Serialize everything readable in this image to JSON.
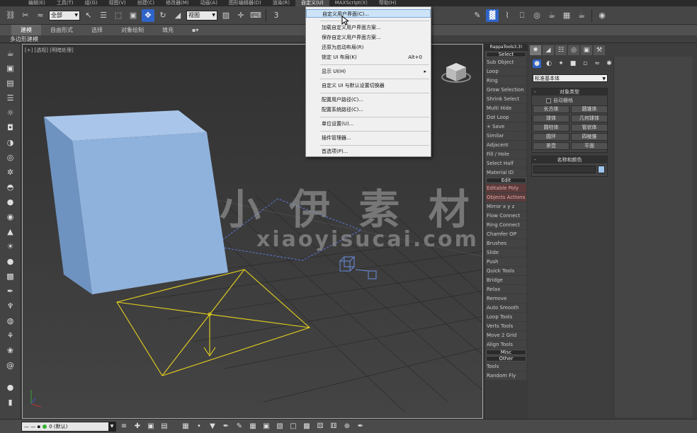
{
  "menubar": {
    "items": [
      "编辑(E)",
      "工具(T)",
      "组(G)",
      "视图(V)",
      "创建(C)",
      "修改器(M)",
      "动画(A)",
      "图形编辑器(D)",
      "渲染(R)",
      "自定义(U)",
      "MAXScript(X)",
      "帮助(H)"
    ]
  },
  "toolbar": {
    "selection_filter": "全部",
    "coord_system": "视图",
    "snap_value": "3"
  },
  "ribbon": {
    "tabs": [
      "建模",
      "自由形式",
      "选择",
      "对象绘制",
      "填充"
    ],
    "subpanel": "多边形建模"
  },
  "viewport": {
    "label": "[+] [透视] [明暗处理]",
    "watermark_main": "小 伊 素 材 网",
    "watermark_sub": "xiaoyisucai.com"
  },
  "dropdown": {
    "items": [
      {
        "label": "自定义用户界面(C)...",
        "shortcut": "",
        "highlighted": true
      },
      {
        "label": "加载自定义用户界面方案...",
        "shortcut": ""
      },
      {
        "label": "保存自定义用户界面方案...",
        "shortcut": ""
      },
      {
        "label": "还原为启动布局(R)",
        "shortcut": ""
      },
      {
        "label": "锁定 UI 布局(K)",
        "shortcut": "Alt+0"
      },
      {
        "label": "显示 UI(H)",
        "shortcut": ""
      },
      {
        "label": "自定义 UI 与默认设置切换器",
        "shortcut": ""
      },
      {
        "label": "配置用户路径(C)...",
        "shortcut": ""
      },
      {
        "label": "配置系统路径(C)...",
        "shortcut": ""
      },
      {
        "label": "单位设置(U)...",
        "shortcut": ""
      },
      {
        "label": "插件管理器...",
        "shortcut": ""
      },
      {
        "label": "首选项(P)...",
        "shortcut": ""
      }
    ]
  },
  "rappa": {
    "title": "RappaTools3.3!",
    "sections": {
      "select": "Select",
      "edit": "Edit",
      "misc": "Misc",
      "other": "Other"
    },
    "select_buttons": [
      "Sub Object",
      "Loop",
      "Ring",
      "Grow Selection",
      "Shrink Select",
      "Multi Hide",
      "Dot Loop",
      "+ Save",
      "Similar",
      "Adjacent",
      "Fill / Hole",
      "Select Half",
      "Material ID"
    ],
    "edit_buttons": [
      "Editable Poly",
      "Objects Actions",
      "Mirror  x  y  z",
      "Flow Connect",
      "Ring Connect",
      "Chamfer OP",
      "Brushes",
      "Slide",
      "Push",
      "Quick Tools",
      "Bridge",
      "Relax",
      "Remove",
      "Auto Smooth",
      "Loop Tools",
      "Verts Tools",
      "Move 2 Grid",
      "Align Tools"
    ],
    "other_buttons": [
      "Tools",
      "Random Fly"
    ]
  },
  "command_panel": {
    "category": "标准基本体",
    "object_type": {
      "header": "对象类型",
      "autogrid": "自动栅格",
      "buttons": [
        "长方体",
        "圆锥体",
        "球体",
        "几何球体",
        "圆柱体",
        "管状体",
        "圆环",
        "四棱锥",
        "茶壶",
        "平面"
      ]
    },
    "name_color": {
      "header": "名称和颜色"
    }
  },
  "bottom": {
    "layer": "0 (默认)"
  },
  "colors": {
    "box": "#8fb2dc",
    "camera": "#e6d21e",
    "highlight": "#cde3f7",
    "accent": "#2f64c8"
  }
}
